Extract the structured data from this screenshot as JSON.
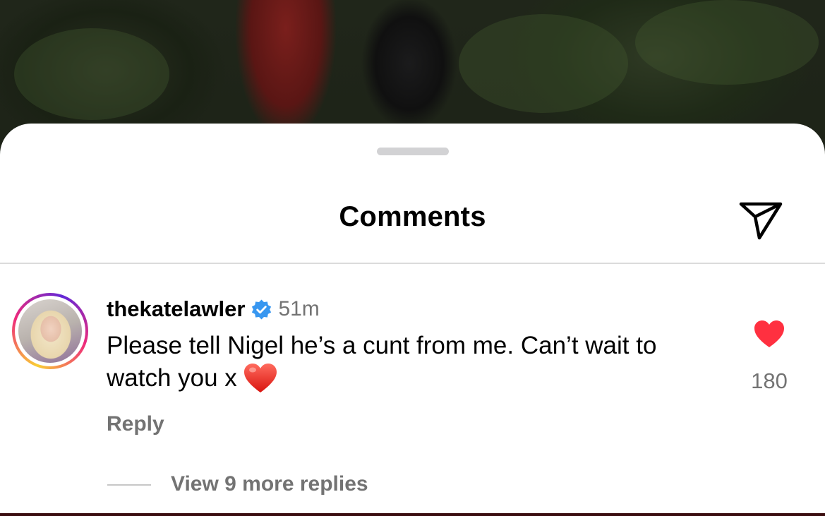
{
  "sheet": {
    "title": "Comments",
    "share_icon": "paper-plane-icon"
  },
  "comment": {
    "username": "thekatelawler",
    "verified_icon": "verified-badge-icon",
    "timestamp": "51m",
    "text": "Please tell Nigel he’s a cunt from me. Can’t wait to watch you x",
    "emoji": "red-heart-emoji",
    "reply_label": "Reply",
    "like_icon": "heart-icon",
    "like_count": "180",
    "liked": true,
    "view_replies_label": "View 9 more replies"
  },
  "colors": {
    "like_red": "#ff3040",
    "verified_blue": "#3897f0",
    "secondary_text": "#737373"
  }
}
